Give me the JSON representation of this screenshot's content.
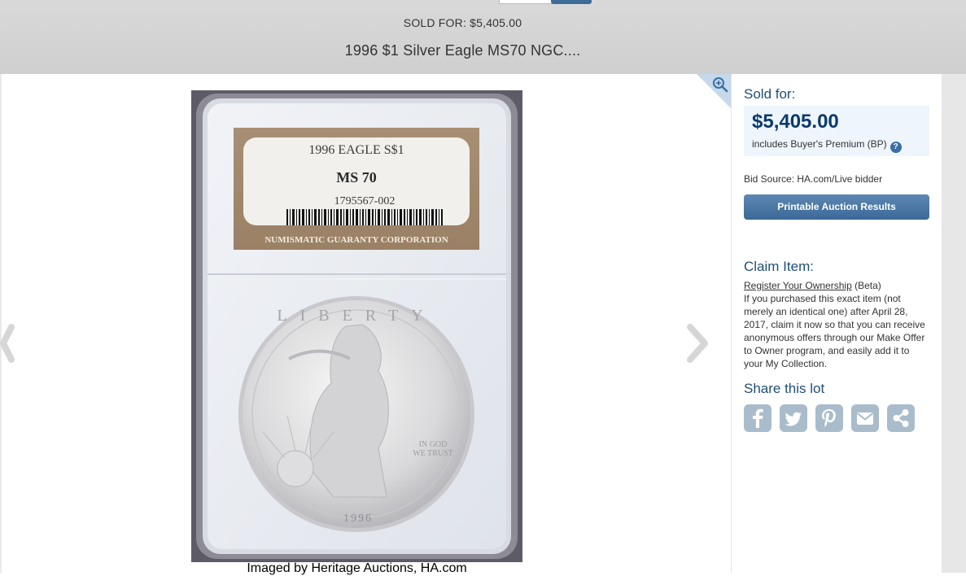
{
  "header": {
    "sold_line": "SOLD FOR: $5,405.00",
    "lot_title": "1996 $1 Silver Eagle MS70 NGC...."
  },
  "coin": {
    "label_line1": "1996 EAGLE S$1",
    "grade": "MS 70",
    "cert_number": "1795567-002",
    "grader": "NUMISMATIC GUARANTY CORPORATION",
    "coin_year": "1996",
    "caption": "Imaged by Heritage Auctions, HA.com"
  },
  "panel": {
    "sold_label": "Sold for:",
    "price": "$5,405.00",
    "premium_text": "includes Buyer's Premium (BP)",
    "help_glyph": "?",
    "bid_source": "Bid Source: HA.com/Live bidder",
    "printable_label": "Printable Auction Results",
    "claim_title": "Claim Item:",
    "register_link": "Register Your Ownership",
    "beta": " (Beta)",
    "claim_body": "If you purchased this exact item (not merely an identical one) after April 28, 2017, claim it now so that you can receive anonymous offers through our Make Offer to Owner program, and easily add it to your My Collection.",
    "share_title": "Share this lot",
    "share_icons": [
      "facebook-icon",
      "twitter-icon",
      "pinterest-icon",
      "email-icon",
      "share-icon"
    ]
  },
  "colors": {
    "heading_blue": "#1f4e79",
    "price_blue": "#0b3a6a",
    "button_blue": "#3c6898",
    "share_gray": "#a9bccb"
  }
}
